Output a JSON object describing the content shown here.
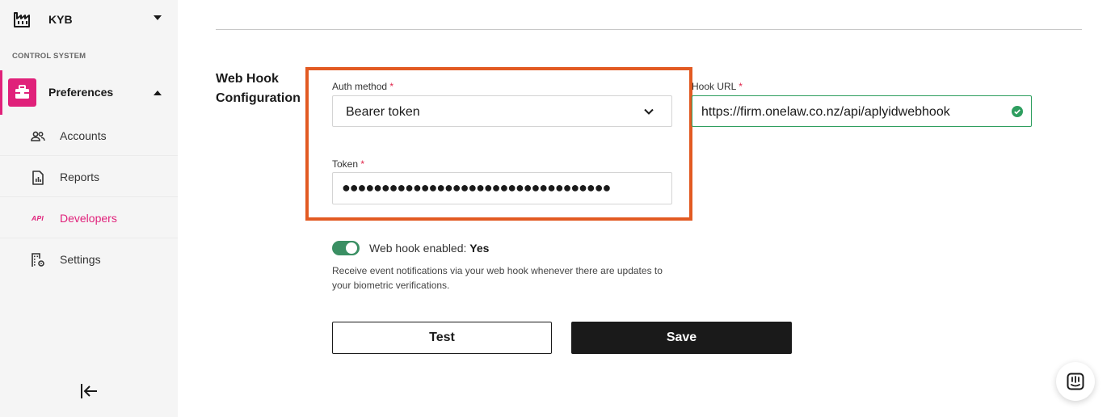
{
  "sidebar": {
    "org_name": "KYB",
    "section_label": "CONTROL SYSTEM",
    "preferences_label": "Preferences",
    "items": [
      {
        "label": "Accounts",
        "icon": "users-icon"
      },
      {
        "label": "Reports",
        "icon": "report-document-icon"
      },
      {
        "label": "Developers",
        "icon": "api-icon",
        "icon_text": "API",
        "active": true
      },
      {
        "label": "Settings",
        "icon": "settings-building-icon"
      }
    ],
    "collapse_icon": "collapse-left-icon"
  },
  "main": {
    "section_title": "Web Hook Configuration",
    "auth_method": {
      "label": "Auth method",
      "required_mark": "*",
      "value": "Bearer token"
    },
    "token": {
      "label": "Token",
      "required_mark": "*",
      "value": "●●●●●●●●●●●●●●●●●●●●●●●●●●●●●●●●●●"
    },
    "hook_url": {
      "label": "Hook URL",
      "required_mark": "*",
      "value": "https://firm.onelaw.co.nz/api/aplyidwebhook",
      "valid": true
    },
    "webhook_toggle": {
      "label": "Web hook enabled:",
      "state_text": "Yes",
      "enabled": true
    },
    "help_text": "Receive event notifications via your web hook whenever there are updates to your biometric verifications.",
    "buttons": {
      "test_label": "Test",
      "save_label": "Save"
    }
  },
  "colors": {
    "accent": "#e0217a",
    "highlight_border": "#e25a22",
    "success": "#2e9e5f",
    "toggle_on": "#3a8f63",
    "primary_button": "#1a1a1a"
  }
}
